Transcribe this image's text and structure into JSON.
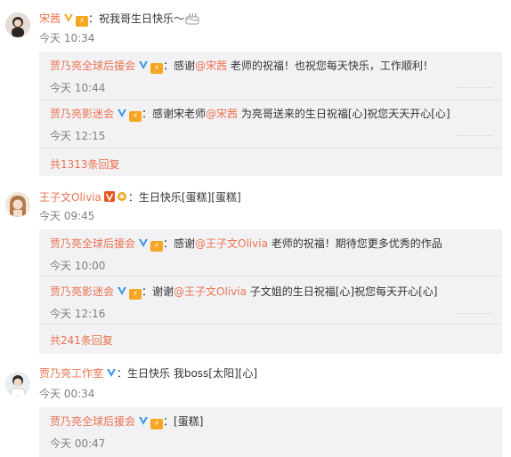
{
  "comments": [
    {
      "author": "宋茜",
      "text": "：祝我哥生日快乐～",
      "time": "今天 10:34",
      "replies": [
        {
          "author": "贾乃亮全球后援会",
          "pre": "：感谢",
          "mention": "@宋茜",
          "post": " 老师的祝福！也祝您每天快乐，工作顺利！",
          "time": "今天 10:44"
        },
        {
          "author": "贾乃亮影迷会",
          "pre": "：感谢宋老师",
          "mention": "@宋茜",
          "post": " 为亮哥送来的生日祝福[心]祝您天天开心[心]",
          "time": "今天 12:15"
        }
      ],
      "more": "共1313条回复"
    },
    {
      "author": "王子文Olivia",
      "text": "：生日快乐[蛋糕][蛋糕]",
      "time": "今天 09:45",
      "replies": [
        {
          "author": "贾乃亮全球后援会",
          "pre": "：感谢",
          "mention": "@王子文Olivia",
          "post": " 老师的祝福！期待您更多优秀的作品",
          "time": "今天 10:00"
        },
        {
          "author": "贾乃亮影迷会",
          "pre": "：谢谢",
          "mention": "@王子文Olivia",
          "post": " 子文姐的生日祝福[心]祝您每天开心[心]",
          "time": "今天 12:16"
        }
      ],
      "more": "共241条回复"
    },
    {
      "author": "贾乃亮工作室",
      "text": "：生日快乐 我boss[太阳][心]",
      "time": "今天 00:34",
      "replies": [
        {
          "author": "贾乃亮全球后援会",
          "pre": "：[蛋糕]",
          "mention": "",
          "post": "",
          "time": "今天 00:47"
        }
      ]
    }
  ],
  "colors": {
    "name": "#eb7350",
    "time": "#808080",
    "reply_bg": "#f2f2f5",
    "vip_blue": "#3a96e6",
    "vip_orange": "#f5a623"
  },
  "icons": [
    "avatar",
    "verified-v-icon",
    "vip-badge-icon",
    "medal-icon",
    "cake-emoji-icon"
  ]
}
